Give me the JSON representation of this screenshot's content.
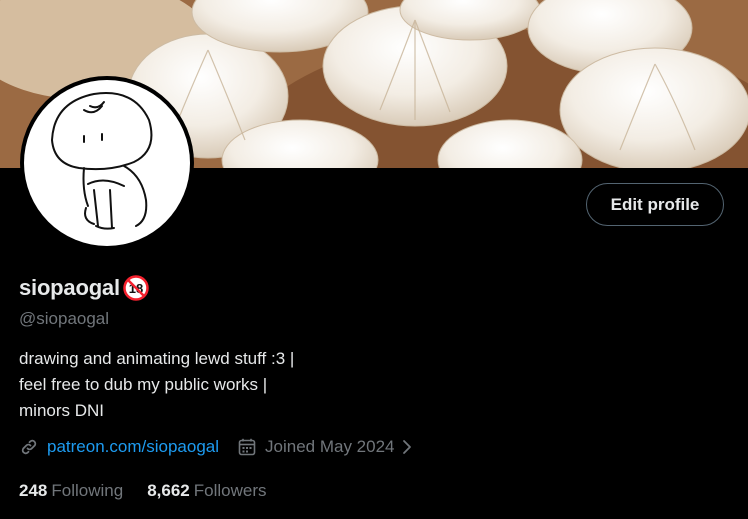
{
  "profile": {
    "display_name": "siopaogal",
    "badge_text": "18",
    "handle": "@siopaogal",
    "bio": [
      "drawing and animating lewd stuff :3 |",
      "feel free to dub my public works |",
      "minors DNI"
    ],
    "link_text": "patreon.com/siopaogal",
    "joined_text": "Joined May 2024",
    "edit_button_label": "Edit profile"
  },
  "stats": {
    "following_count": "248",
    "following_label": "Following",
    "followers_count": "8,662",
    "followers_label": "Followers"
  },
  "icons": {
    "link": "link-icon",
    "calendar": "calendar-icon",
    "chevron": "chevron-right-icon",
    "no-minors": "no-under-18-icon"
  },
  "colors": {
    "background": "#000000",
    "text": "#e7e9ea",
    "muted": "#71767b",
    "link": "#1d9bf0",
    "button_border": "#536471",
    "badge_red": "#f4212e"
  }
}
